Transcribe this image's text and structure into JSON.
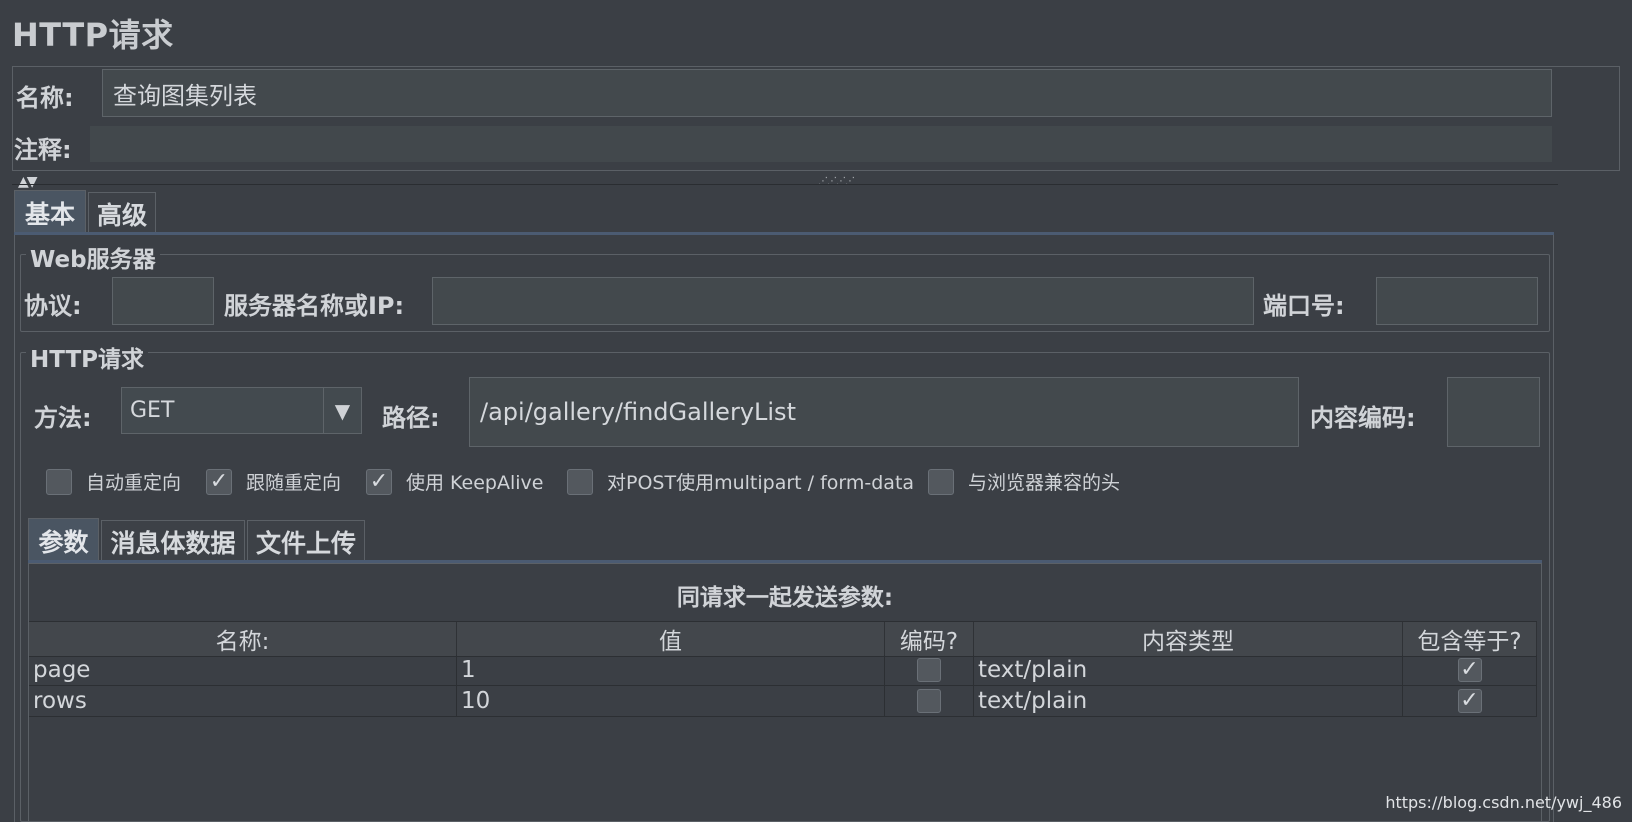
{
  "title": "HTTP请求",
  "name_label": "名称:",
  "name_value": "查询图集列表",
  "comment_label": "注释:",
  "comment_value": "",
  "splitter_arrows": "▲▼",
  "splitter_grip": "⋰⋰⋰⋰",
  "tabs": [
    {
      "label": "基本",
      "active": true
    },
    {
      "label": "高级",
      "active": false
    }
  ],
  "web_server": {
    "title": "Web服务器",
    "protocol_label": "协议:",
    "protocol_value": "",
    "server_label": "服务器名称或IP:",
    "server_value": "",
    "port_label": "端口号:",
    "port_value": ""
  },
  "http_request": {
    "title": "HTTP请求",
    "method_label": "方法:",
    "method_value": "GET",
    "method_arrow": "▼",
    "path_label": "路径:",
    "path_value": "/api/gallery/findGalleryList",
    "encoding_label": "内容编码:",
    "encoding_value": ""
  },
  "options": [
    {
      "label": "自动重定向",
      "checked": false
    },
    {
      "label": "跟随重定向",
      "checked": true
    },
    {
      "label": "使用 KeepAlive",
      "checked": true
    },
    {
      "label": "对POST使用multipart / form-data",
      "checked": false
    },
    {
      "label": "与浏览器兼容的头",
      "checked": false
    }
  ],
  "sub_tabs": [
    {
      "label": "参数",
      "active": true
    },
    {
      "label": "消息体数据",
      "active": false
    },
    {
      "label": "文件上传",
      "active": false
    }
  ],
  "params": {
    "heading": "同请求一起发送参数:",
    "columns": [
      "名称:",
      "值",
      "编码?",
      "内容类型",
      "包含等于?"
    ],
    "rows": [
      {
        "name": "page",
        "value": "1",
        "encode": false,
        "content_type": "text/plain",
        "include_equals": true
      },
      {
        "name": "rows",
        "value": "10",
        "encode": false,
        "content_type": "text/plain",
        "include_equals": true
      }
    ]
  },
  "check_glyph": "✓",
  "watermark": "https://blog.csdn.net/ywj_486"
}
